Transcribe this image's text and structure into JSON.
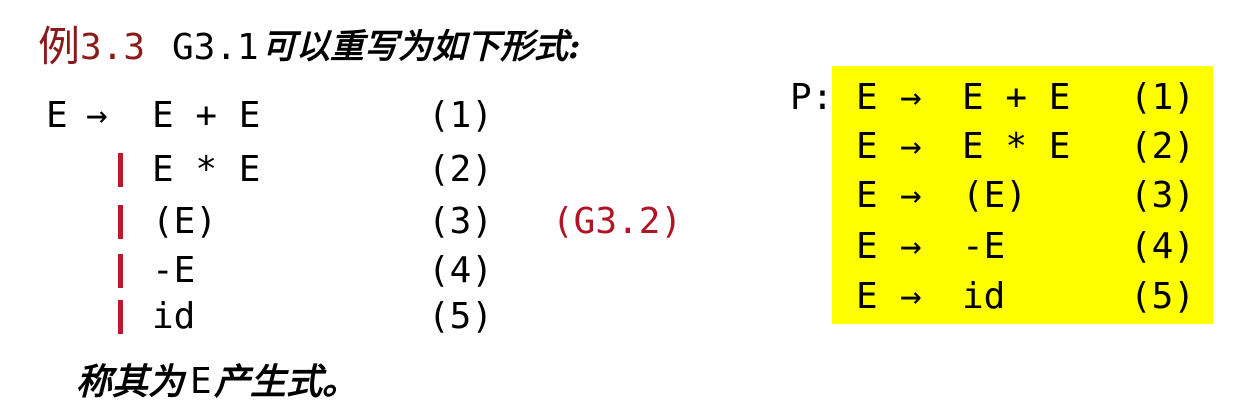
{
  "title": {
    "prefix": "例",
    "number": "3.3",
    "grammar": "G3.1",
    "text": "可以重写为如下形式:"
  },
  "left_rules": {
    "lhs": "E",
    "arrow": "→",
    "alternatives": [
      {
        "rhs": "E + E",
        "num": "(1)"
      },
      {
        "rhs": "E * E",
        "num": "(2)"
      },
      {
        "rhs": "(E)",
        "num": "(3)"
      },
      {
        "rhs": "-E",
        "num": "(4)"
      },
      {
        "rhs": "id",
        "num": "(5)"
      }
    ],
    "grammar_label": "(G3.2)"
  },
  "productions": {
    "label": "P:",
    "items": [
      {
        "lhs": "E",
        "arrow": "→",
        "rhs": "E + E",
        "num": "(1)"
      },
      {
        "lhs": "E",
        "arrow": "→",
        "rhs": "E * E",
        "num": "(2)"
      },
      {
        "lhs": "E",
        "arrow": "→",
        "rhs": "(E)",
        "num": "(3)"
      },
      {
        "lhs": "E",
        "arrow": "→",
        "rhs": "-E",
        "num": "(4)"
      },
      {
        "lhs": "E",
        "arrow": "→",
        "rhs": "id",
        "num": "(5)"
      }
    ],
    "highlight_color": "#ffff00"
  },
  "footer": {
    "pre": "称其为",
    "symbol": "E",
    "post": "产生式。"
  },
  "colors": {
    "title_accent": "#8b1a1a",
    "bar": "#c0162a",
    "grammar_label": "#b01525"
  }
}
